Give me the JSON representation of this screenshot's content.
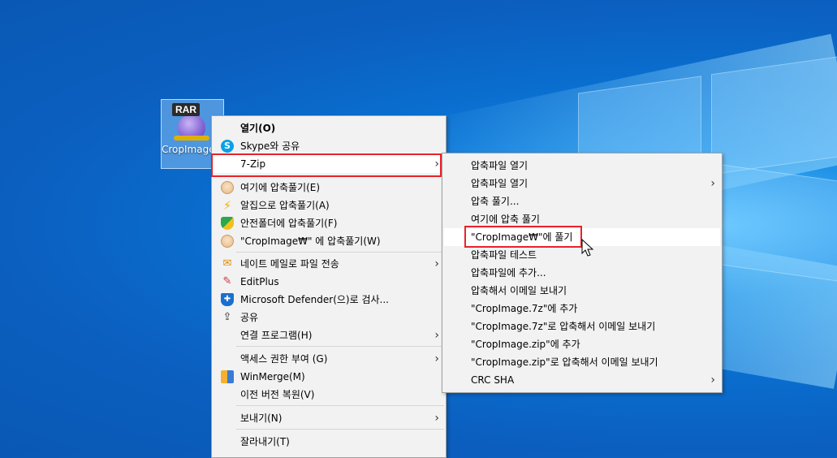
{
  "desktop": {
    "icon": {
      "badge": "RAR",
      "label": "CropImage.rar"
    }
  },
  "main_menu": {
    "items": [
      {
        "label": "열기(O)",
        "icon": "",
        "bold": true
      },
      {
        "label": "Skype와 공유",
        "icon": "skype-icon"
      },
      {
        "label": "7-Zip",
        "icon": "",
        "submenu": true,
        "highlighted": true
      },
      {
        "label": "여기에 압축풀기(E)",
        "icon": "alzip-bag-icon"
      },
      {
        "label": "알집으로 압축풀기(A)",
        "icon": "alzip-bolt-icon"
      },
      {
        "label": "안전폴더에 압축풀기(F)",
        "icon": "shield-icon"
      },
      {
        "label": "\"CropImage₩\" 에 압축풀기(W)",
        "icon": "alzip-bag-icon"
      },
      {
        "label": "네이트 메일로 파일 전송",
        "icon": "nate-mail-icon",
        "submenu": true
      },
      {
        "label": "EditPlus",
        "icon": "editplus-icon"
      },
      {
        "label": "Microsoft Defender(으)로 검사...",
        "icon": "defender-icon"
      },
      {
        "label": "공유",
        "icon": "share-icon"
      },
      {
        "label": "연결 프로그램(H)",
        "icon": "",
        "submenu": true
      },
      {
        "label": "액세스 권한 부여 (G)",
        "icon": "",
        "submenu": true
      },
      {
        "label": "WinMerge(M)",
        "icon": "winmerge-icon"
      },
      {
        "label": "이전 버전 복원(V)",
        "icon": ""
      },
      {
        "label": "보내기(N)",
        "icon": "",
        "submenu": true
      },
      {
        "label": "잘라내기(T)",
        "icon": ""
      }
    ]
  },
  "sub_menu": {
    "items": [
      {
        "label": "압축파일 열기"
      },
      {
        "label": "압축파일 열기",
        "submenu": true
      },
      {
        "label": "압축 풀기..."
      },
      {
        "label": "여기에 압축 풀기"
      },
      {
        "label": "\"CropImage₩\"에 풀기",
        "highlighted": true
      },
      {
        "label": "압축파일 테스트"
      },
      {
        "label": "압축파일에 추가..."
      },
      {
        "label": "압축해서 이메일 보내기"
      },
      {
        "label": "\"CropImage.7z\"에 추가"
      },
      {
        "label": "\"CropImage.7z\"로 압축해서 이메일 보내기"
      },
      {
        "label": "\"CropImage.zip\"에 추가"
      },
      {
        "label": "\"CropImage.zip\"로 압축해서 이메일 보내기"
      },
      {
        "label": "CRC SHA",
        "submenu": true
      }
    ]
  },
  "colors": {
    "highlight_box": "#e8232a",
    "menu_bg": "#f2f2f2",
    "desktop": "#0a6fd0"
  }
}
